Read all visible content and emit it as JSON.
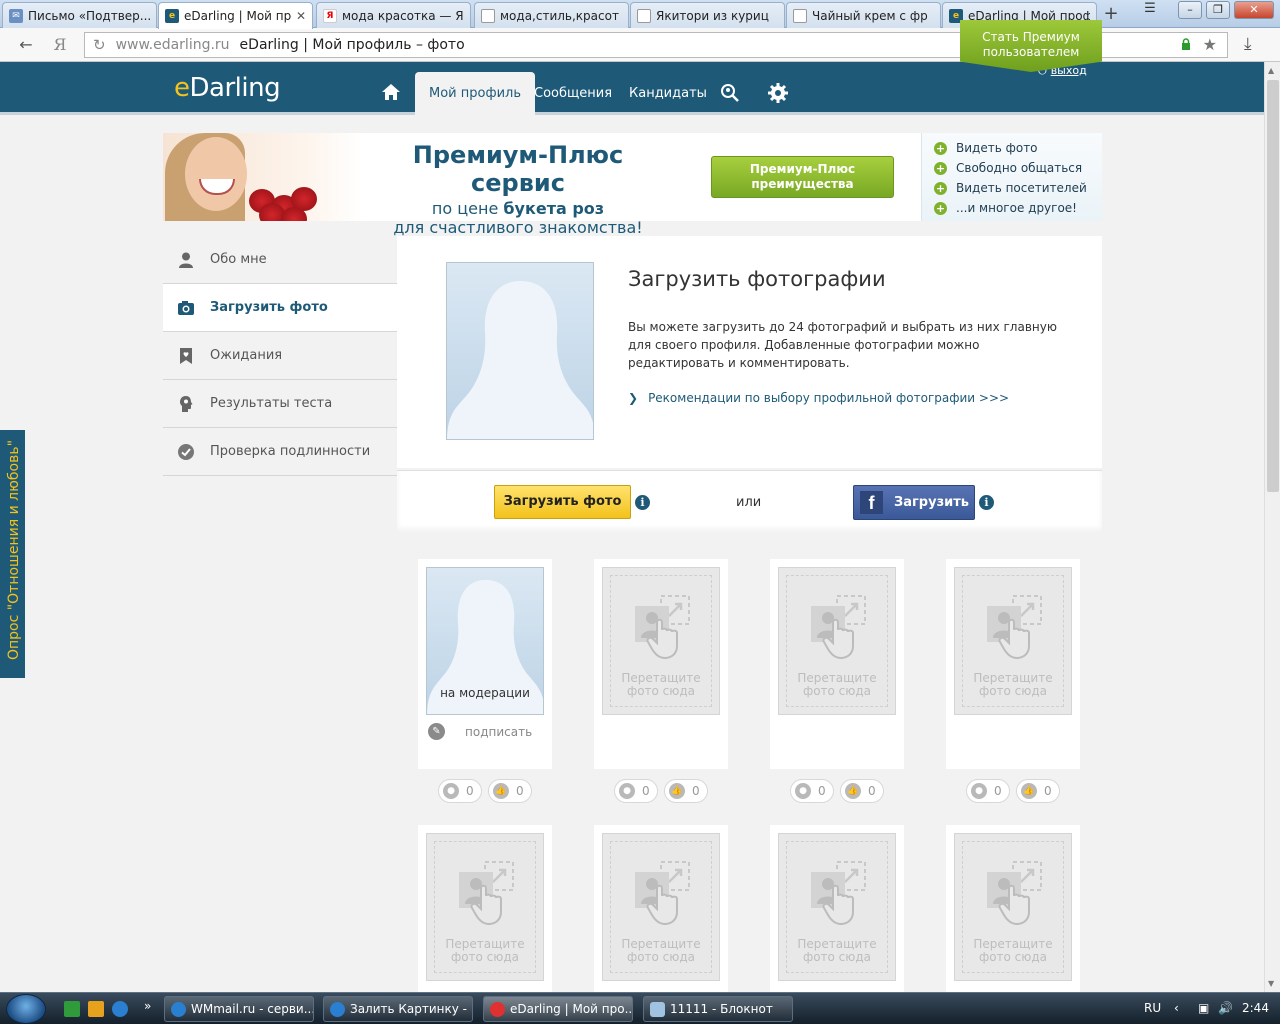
{
  "browser": {
    "tabs": [
      {
        "label": "Письмо «Подтвер...",
        "icon": "mail-icon",
        "active": false
      },
      {
        "label": "eDarling | Мой проф",
        "icon": "edarling-favicon",
        "active": true
      },
      {
        "label": "мода красотка — Я",
        "icon": "yandex-favicon",
        "active": false
      },
      {
        "label": "мода,стиль,красот",
        "icon": "page-icon",
        "active": false
      },
      {
        "label": "Якитори из куриц",
        "icon": "page-icon",
        "active": false
      },
      {
        "label": "Чайный крем с фр",
        "icon": "page-icon",
        "active": false
      },
      {
        "label": "eDarling | Мой проф",
        "icon": "edarling-favicon",
        "active": false
      }
    ],
    "address": {
      "url": "www.edarling.ru",
      "title": "eDarling | Мой профиль – фото"
    }
  },
  "header": {
    "logo_e": "e",
    "logo_rest": "Darling",
    "nav": {
      "profile": "Мой профиль",
      "messages": "Сообщения",
      "candidates": "Кандидаты"
    },
    "logout": "выход",
    "premium_flag": "Стать Премиум пользователем"
  },
  "banner": {
    "title": "Премиум-Плюс сервис",
    "line2_prefix": "по цене ",
    "line2_bold": "букета роз",
    "line3": "для счастливого знакомства!",
    "button": "Премиум-Плюс преимущества",
    "features": [
      "Видеть фото",
      "Свободно общаться",
      "Видеть посетителей",
      "...и многое другое!"
    ]
  },
  "sidebar": {
    "items": [
      {
        "label": "Обо мне",
        "icon": "person-icon"
      },
      {
        "label": "Загрузить фото",
        "icon": "camera-icon"
      },
      {
        "label": "Ожидания",
        "icon": "bookmark-heart-icon"
      },
      {
        "label": "Результаты теста",
        "icon": "head-icon"
      },
      {
        "label": "Проверка подлинности",
        "icon": "check-circle-icon"
      }
    ]
  },
  "upload": {
    "title": "Загрузить фотографии",
    "description": "Вы можете загрузить до 24 фотографий и выбрать из них главную для своего профиля. Добавленные фотографии можно редактировать и комментировать.",
    "recommendation_link": "Рекомендации по выбору профильной фотографии >>>",
    "upload_button": "Загрузить фото",
    "or": "или",
    "facebook_button": "Загрузить"
  },
  "photos": {
    "moderation_label": "на модерации",
    "sign_label": "подписать",
    "drop_text_1": "Перетащите",
    "drop_text_2": "фото сюда",
    "counters": [
      {
        "views": "0",
        "likes": "0"
      },
      {
        "views": "0",
        "likes": "0"
      },
      {
        "views": "0",
        "likes": "0"
      },
      {
        "views": "0",
        "likes": "0"
      }
    ]
  },
  "survey_tab": "Опрос \"Отношения и любовь\"",
  "taskbar": {
    "tasks": [
      {
        "label": "WMmail.ru - серви...",
        "active": false
      },
      {
        "label": "Залить Картинку - ...",
        "active": false
      },
      {
        "label": "eDarling | Мой про...",
        "active": true
      },
      {
        "label": "11111 - Блокнот",
        "active": false
      }
    ],
    "lang": "RU",
    "time": "2:44"
  },
  "colors": {
    "brand_blue": "#1e5a78",
    "brand_yellow": "#f3c21c",
    "premium_green": "#8fbf30",
    "facebook_blue": "#3b5998"
  }
}
